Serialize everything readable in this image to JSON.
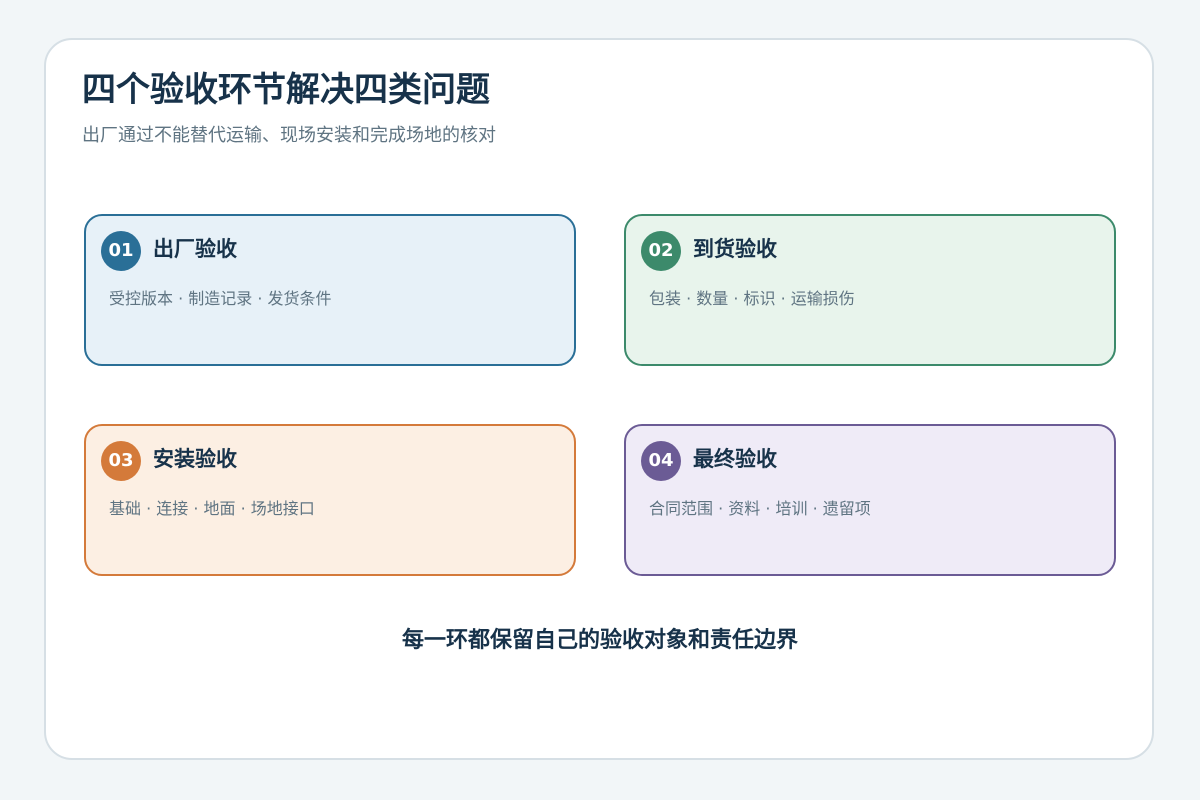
{
  "header": {
    "title": "四个验收环节解决四类问题",
    "subtitle": "出厂通过不能替代运输、现场安装和完成场地的核对"
  },
  "stages": [
    {
      "number": "01",
      "title": "出厂验收",
      "detail": "受控版本 · 制造记录 · 发货条件",
      "colors": {
        "accent": "#2a6f97",
        "fill": "#e7f1f8",
        "border": "#2a6f97"
      }
    },
    {
      "number": "02",
      "title": "到货验收",
      "detail": "包装 · 数量 · 标识 · 运输损伤",
      "colors": {
        "accent": "#3c8a6b",
        "fill": "#e8f4ec",
        "border": "#3c8a6b"
      }
    },
    {
      "number": "03",
      "title": "安装验收",
      "detail": "基础 · 连接 · 地面 · 场地接口",
      "colors": {
        "accent": "#d47a3a",
        "fill": "#fcefe3",
        "border": "#d47a3a"
      }
    },
    {
      "number": "04",
      "title": "最终验收",
      "detail": "合同范围 · 资料 · 培训 · 遗留项",
      "colors": {
        "accent": "#6b5b95",
        "fill": "#efebf7",
        "border": "#6b5b95"
      }
    }
  ],
  "footer": {
    "note": "每一环都保留自己的验收对象和责任边界"
  }
}
